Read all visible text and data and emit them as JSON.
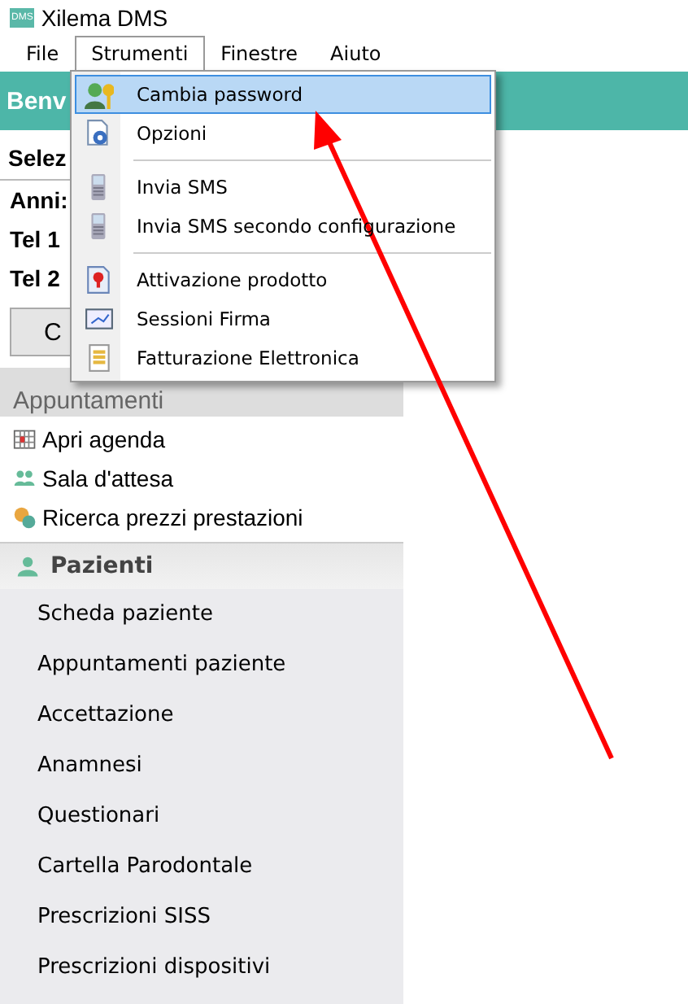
{
  "window": {
    "logo": "DMS",
    "title": "Xilema  DMS"
  },
  "menu_bar": [
    {
      "label": "File",
      "selected": false
    },
    {
      "label": "Strumenti",
      "selected": true
    },
    {
      "label": "Finestre",
      "selected": false
    },
    {
      "label": "Aiuto",
      "selected": false
    }
  ],
  "banner": {
    "title": "Benv"
  },
  "patient_panel": {
    "header": "Selez",
    "fields": [
      "Anni:",
      "Tel 1",
      "Tel 2"
    ],
    "button": "C"
  },
  "sections": [
    {
      "title": "Appuntamenti",
      "kind": "plain",
      "items": [
        {
          "label": "Apri agenda"
        },
        {
          "label": "Sala d'attesa"
        },
        {
          "label": "Ricerca prezzi prestazioni"
        }
      ]
    },
    {
      "title": "Pazienti",
      "kind": "bold",
      "items": [
        {
          "label": "Scheda paziente"
        },
        {
          "label": "Appuntamenti paziente"
        },
        {
          "label": "Accettazione"
        },
        {
          "label": "Anamnesi"
        },
        {
          "label": "Questionari"
        },
        {
          "label": "Cartella Parodontale"
        },
        {
          "label": "Prescrizioni SISS"
        },
        {
          "label": "Prescrizioni dispositivi"
        }
      ]
    }
  ],
  "dropdown": {
    "items": [
      {
        "kind": "item",
        "label": "Cambia password",
        "selected": true
      },
      {
        "kind": "item",
        "label": "Opzioni",
        "selected": false
      },
      {
        "kind": "separator"
      },
      {
        "kind": "item",
        "label": "Invia SMS",
        "selected": false
      },
      {
        "kind": "item",
        "label": "Invia SMS secondo configurazione",
        "selected": false
      },
      {
        "kind": "separator"
      },
      {
        "kind": "item",
        "label": "Attivazione prodotto",
        "selected": false
      },
      {
        "kind": "item",
        "label": "Sessioni Firma",
        "selected": false
      },
      {
        "kind": "item",
        "label": "Fatturazione Elettronica",
        "selected": false
      }
    ]
  }
}
